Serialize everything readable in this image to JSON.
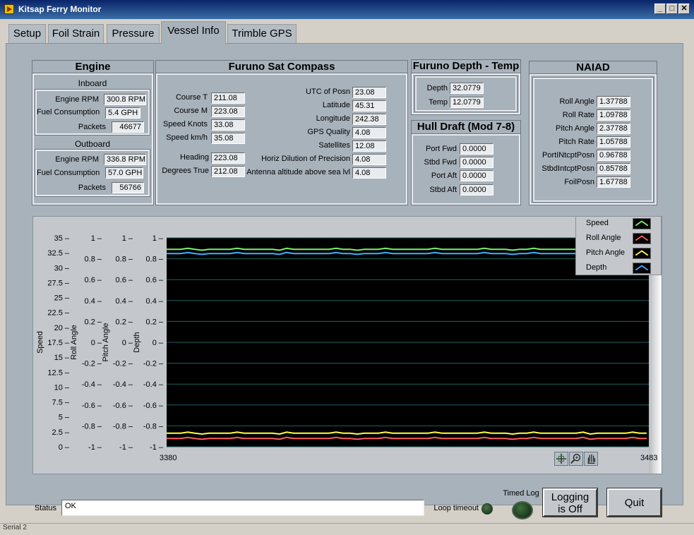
{
  "window": {
    "title": "Kitsap Ferry Monitor"
  },
  "tabs": [
    {
      "label": "Setup"
    },
    {
      "label": "Foil Strain"
    },
    {
      "label": "Pressure"
    },
    {
      "label": "Vessel Info"
    },
    {
      "label": "Trimble GPS"
    }
  ],
  "engine": {
    "title": "Engine",
    "inboard": {
      "title": "Inboard",
      "rpm_label": "Engine RPM",
      "rpm": "300.8 RPM",
      "fuel_label": "Fuel Consumption",
      "fuel": "5.4 GPH",
      "packets_label": "Packets",
      "packets": "46677"
    },
    "outboard": {
      "title": "Outboard",
      "rpm_label": "Engine RPM",
      "rpm": "336.8 RPM",
      "fuel_label": "Fuel Consumption",
      "fuel": "57.0 GPH",
      "packets_label": "Packets",
      "packets": "56766"
    }
  },
  "compass": {
    "title": "Furuno Sat Compass",
    "left": [
      {
        "label": "Course T",
        "value": "211.08"
      },
      {
        "label": "Course M",
        "value": "223.08"
      },
      {
        "label": "Speed Knots",
        "value": "33.08"
      },
      {
        "label": "Speed km/h",
        "value": "35.08"
      },
      {
        "label": "Heading",
        "value": "223.08"
      },
      {
        "label": "Degrees True",
        "value": "212.08"
      }
    ],
    "right": [
      {
        "label": "UTC of Posn",
        "value": "23.08"
      },
      {
        "label": "Latitude",
        "value": "45.31"
      },
      {
        "label": "Longitude",
        "value": "242.38"
      },
      {
        "label": "GPS Quality",
        "value": "4.08"
      },
      {
        "label": "Satellites",
        "value": "12.08"
      },
      {
        "label": "Horiz Dilution of Precision",
        "value": "4.08"
      },
      {
        "label": "Antenna altitude above sea lvl",
        "value": "4.08"
      }
    ]
  },
  "depth_temp": {
    "title": "Furuno Depth - Temp",
    "depth_label": "Depth",
    "depth": "32.0779",
    "temp_label": "Temp",
    "temp": "12.0779"
  },
  "hull_draft": {
    "title": "Hull Draft (Mod 7-8)",
    "rows": [
      {
        "label": "Port Fwd",
        "value": "0.0000"
      },
      {
        "label": "Stbd Fwd",
        "value": "0.0000"
      },
      {
        "label": "Port Aft",
        "value": "0.0000"
      },
      {
        "label": "Stbd Aft",
        "value": "0.0000"
      }
    ]
  },
  "naiad": {
    "title": "NAIAD",
    "rows": [
      {
        "label": "Roll Angle",
        "value": "1.37788"
      },
      {
        "label": "Roll Rate",
        "value": "1.09788"
      },
      {
        "label": "Pitch Angle",
        "value": "2.37788"
      },
      {
        "label": "Pitch Rate",
        "value": "1.05788"
      },
      {
        "label": "PortINtcptPosn",
        "value": "0.96788"
      },
      {
        "label": "StbdIntcptPosn",
        "value": "0.85788"
      },
      {
        "label": "FoilPosn",
        "value": "1.67788"
      }
    ]
  },
  "chart_data": {
    "type": "line",
    "x_range": [
      3380,
      3483
    ],
    "x_tick_labels": [
      "3380",
      "3483"
    ],
    "axes": [
      {
        "name": "Speed",
        "range": [
          0,
          35
        ],
        "ticks": [
          "35",
          "32.5",
          "30",
          "27.5",
          "25",
          "22.5",
          "20",
          "17.5",
          "15",
          "12.5",
          "10",
          "7.5",
          "5",
          "2.5",
          "0"
        ]
      },
      {
        "name": "Roll Angle",
        "range": [
          -1,
          1
        ],
        "ticks": [
          "1",
          "0.8",
          "0.6",
          "0.4",
          "0.2",
          "0",
          "-0.2",
          "-0.4",
          "-0.6",
          "-0.8",
          "-1"
        ]
      },
      {
        "name": "Pitch Angle",
        "range": [
          -1,
          1
        ],
        "ticks": [
          "1",
          "0.8",
          "0.6",
          "0.4",
          "0.2",
          "0",
          "-0.2",
          "-0.4",
          "-0.6",
          "-0.8",
          "-1"
        ]
      },
      {
        "name": "Depth",
        "range": [
          -1,
          1
        ],
        "ticks": [
          "1",
          "0.8",
          "0.6",
          "0.4",
          "0.2",
          "0",
          "-0.2",
          "-0.4",
          "-0.6",
          "-0.8",
          "-1"
        ]
      }
    ],
    "series": [
      {
        "name": "Speed",
        "color": "#7cf06c",
        "level": 0.89
      },
      {
        "name": "Roll Angle",
        "color": "#ff5a5a",
        "level": -0.92
      },
      {
        "name": "Pitch Angle",
        "color": "#ffff40",
        "level": -0.87
      },
      {
        "name": "Depth",
        "color": "#40b0ff",
        "level": 0.85
      }
    ],
    "grid": true,
    "legend_position": "top-right"
  },
  "legend": [
    {
      "label": "Speed",
      "color": "#7cf06c"
    },
    {
      "label": "Roll Angle",
      "color": "#ff5a5a"
    },
    {
      "label": "Pitch Angle",
      "color": "#ffff40"
    },
    {
      "label": "Depth",
      "color": "#40b0ff"
    }
  ],
  "graph_tools": [
    "crosshair-icon",
    "zoom-icon",
    "hand-icon"
  ],
  "bottom": {
    "status_label": "Status",
    "status_value": "OK",
    "loop_timeout_label": "Loop timeout",
    "timed_log_label": "Timed Log",
    "logging_line1": "Logging",
    "logging_line2": "is Off",
    "quit_label": "Quit",
    "statusbar_text": "Serial 2"
  }
}
